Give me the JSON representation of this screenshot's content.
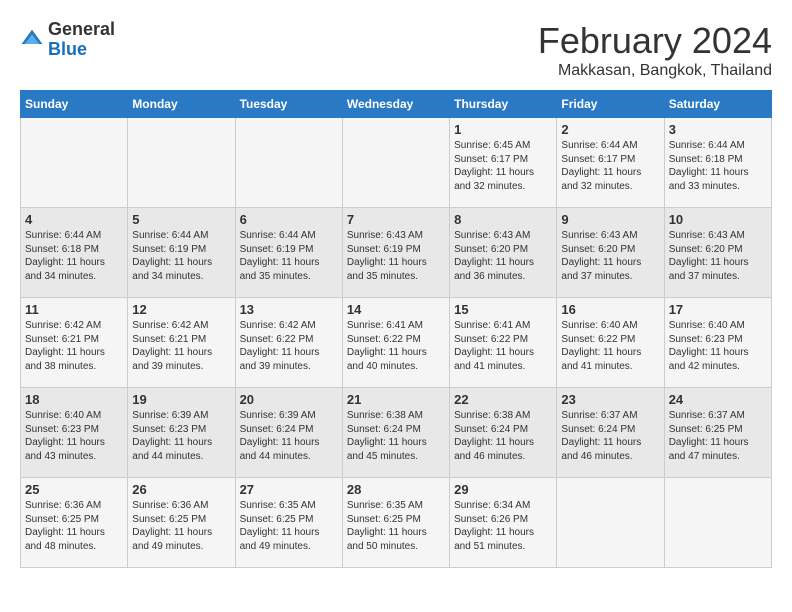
{
  "header": {
    "logo": {
      "general": "General",
      "blue": "Blue"
    },
    "title": "February 2024",
    "subtitle": "Makkasan, Bangkok, Thailand"
  },
  "calendar": {
    "days_of_week": [
      "Sunday",
      "Monday",
      "Tuesday",
      "Wednesday",
      "Thursday",
      "Friday",
      "Saturday"
    ],
    "weeks": [
      [
        {
          "day": "",
          "sunrise": "",
          "sunset": "",
          "daylight": ""
        },
        {
          "day": "",
          "sunrise": "",
          "sunset": "",
          "daylight": ""
        },
        {
          "day": "",
          "sunrise": "",
          "sunset": "",
          "daylight": ""
        },
        {
          "day": "",
          "sunrise": "",
          "sunset": "",
          "daylight": ""
        },
        {
          "day": "1",
          "sunrise": "Sunrise: 6:45 AM",
          "sunset": "Sunset: 6:17 PM",
          "daylight": "Daylight: 11 hours and 32 minutes."
        },
        {
          "day": "2",
          "sunrise": "Sunrise: 6:44 AM",
          "sunset": "Sunset: 6:17 PM",
          "daylight": "Daylight: 11 hours and 32 minutes."
        },
        {
          "day": "3",
          "sunrise": "Sunrise: 6:44 AM",
          "sunset": "Sunset: 6:18 PM",
          "daylight": "Daylight: 11 hours and 33 minutes."
        }
      ],
      [
        {
          "day": "4",
          "sunrise": "Sunrise: 6:44 AM",
          "sunset": "Sunset: 6:18 PM",
          "daylight": "Daylight: 11 hours and 34 minutes."
        },
        {
          "day": "5",
          "sunrise": "Sunrise: 6:44 AM",
          "sunset": "Sunset: 6:19 PM",
          "daylight": "Daylight: 11 hours and 34 minutes."
        },
        {
          "day": "6",
          "sunrise": "Sunrise: 6:44 AM",
          "sunset": "Sunset: 6:19 PM",
          "daylight": "Daylight: 11 hours and 35 minutes."
        },
        {
          "day": "7",
          "sunrise": "Sunrise: 6:43 AM",
          "sunset": "Sunset: 6:19 PM",
          "daylight": "Daylight: 11 hours and 35 minutes."
        },
        {
          "day": "8",
          "sunrise": "Sunrise: 6:43 AM",
          "sunset": "Sunset: 6:20 PM",
          "daylight": "Daylight: 11 hours and 36 minutes."
        },
        {
          "day": "9",
          "sunrise": "Sunrise: 6:43 AM",
          "sunset": "Sunset: 6:20 PM",
          "daylight": "Daylight: 11 hours and 37 minutes."
        },
        {
          "day": "10",
          "sunrise": "Sunrise: 6:43 AM",
          "sunset": "Sunset: 6:20 PM",
          "daylight": "Daylight: 11 hours and 37 minutes."
        }
      ],
      [
        {
          "day": "11",
          "sunrise": "Sunrise: 6:42 AM",
          "sunset": "Sunset: 6:21 PM",
          "daylight": "Daylight: 11 hours and 38 minutes."
        },
        {
          "day": "12",
          "sunrise": "Sunrise: 6:42 AM",
          "sunset": "Sunset: 6:21 PM",
          "daylight": "Daylight: 11 hours and 39 minutes."
        },
        {
          "day": "13",
          "sunrise": "Sunrise: 6:42 AM",
          "sunset": "Sunset: 6:22 PM",
          "daylight": "Daylight: 11 hours and 39 minutes."
        },
        {
          "day": "14",
          "sunrise": "Sunrise: 6:41 AM",
          "sunset": "Sunset: 6:22 PM",
          "daylight": "Daylight: 11 hours and 40 minutes."
        },
        {
          "day": "15",
          "sunrise": "Sunrise: 6:41 AM",
          "sunset": "Sunset: 6:22 PM",
          "daylight": "Daylight: 11 hours and 41 minutes."
        },
        {
          "day": "16",
          "sunrise": "Sunrise: 6:40 AM",
          "sunset": "Sunset: 6:22 PM",
          "daylight": "Daylight: 11 hours and 41 minutes."
        },
        {
          "day": "17",
          "sunrise": "Sunrise: 6:40 AM",
          "sunset": "Sunset: 6:23 PM",
          "daylight": "Daylight: 11 hours and 42 minutes."
        }
      ],
      [
        {
          "day": "18",
          "sunrise": "Sunrise: 6:40 AM",
          "sunset": "Sunset: 6:23 PM",
          "daylight": "Daylight: 11 hours and 43 minutes."
        },
        {
          "day": "19",
          "sunrise": "Sunrise: 6:39 AM",
          "sunset": "Sunset: 6:23 PM",
          "daylight": "Daylight: 11 hours and 44 minutes."
        },
        {
          "day": "20",
          "sunrise": "Sunrise: 6:39 AM",
          "sunset": "Sunset: 6:24 PM",
          "daylight": "Daylight: 11 hours and 44 minutes."
        },
        {
          "day": "21",
          "sunrise": "Sunrise: 6:38 AM",
          "sunset": "Sunset: 6:24 PM",
          "daylight": "Daylight: 11 hours and 45 minutes."
        },
        {
          "day": "22",
          "sunrise": "Sunrise: 6:38 AM",
          "sunset": "Sunset: 6:24 PM",
          "daylight": "Daylight: 11 hours and 46 minutes."
        },
        {
          "day": "23",
          "sunrise": "Sunrise: 6:37 AM",
          "sunset": "Sunset: 6:24 PM",
          "daylight": "Daylight: 11 hours and 46 minutes."
        },
        {
          "day": "24",
          "sunrise": "Sunrise: 6:37 AM",
          "sunset": "Sunset: 6:25 PM",
          "daylight": "Daylight: 11 hours and 47 minutes."
        }
      ],
      [
        {
          "day": "25",
          "sunrise": "Sunrise: 6:36 AM",
          "sunset": "Sunset: 6:25 PM",
          "daylight": "Daylight: 11 hours and 48 minutes."
        },
        {
          "day": "26",
          "sunrise": "Sunrise: 6:36 AM",
          "sunset": "Sunset: 6:25 PM",
          "daylight": "Daylight: 11 hours and 49 minutes."
        },
        {
          "day": "27",
          "sunrise": "Sunrise: 6:35 AM",
          "sunset": "Sunset: 6:25 PM",
          "daylight": "Daylight: 11 hours and 49 minutes."
        },
        {
          "day": "28",
          "sunrise": "Sunrise: 6:35 AM",
          "sunset": "Sunset: 6:25 PM",
          "daylight": "Daylight: 11 hours and 50 minutes."
        },
        {
          "day": "29",
          "sunrise": "Sunrise: 6:34 AM",
          "sunset": "Sunset: 6:26 PM",
          "daylight": "Daylight: 11 hours and 51 minutes."
        },
        {
          "day": "",
          "sunrise": "",
          "sunset": "",
          "daylight": ""
        },
        {
          "day": "",
          "sunrise": "",
          "sunset": "",
          "daylight": ""
        }
      ]
    ]
  }
}
